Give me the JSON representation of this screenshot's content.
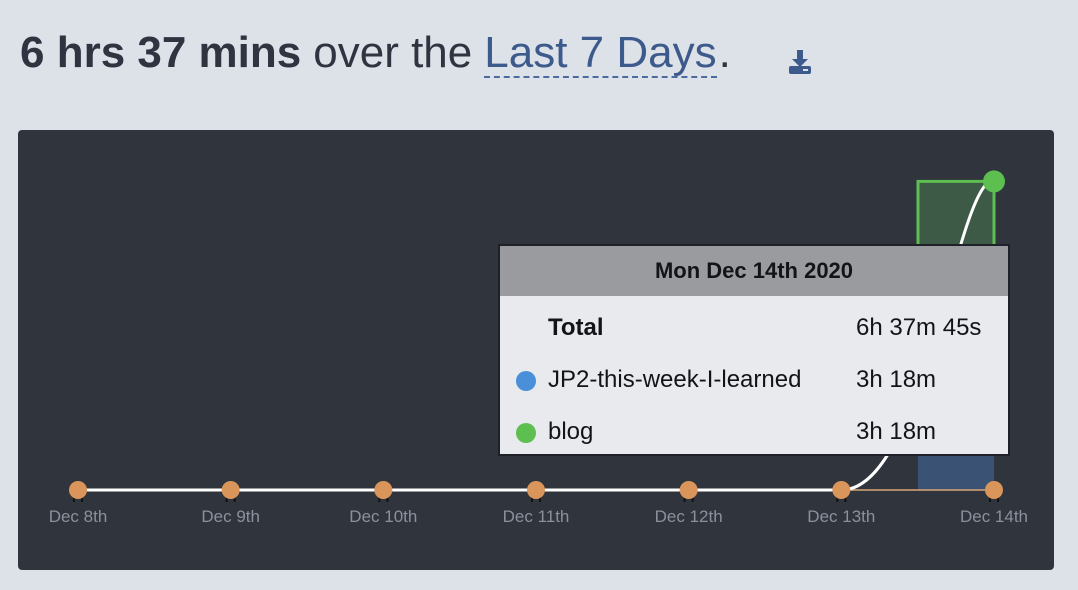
{
  "header": {
    "total": "6 hrs 37 mins",
    "mid_text": "over the",
    "range_link": "Last 7 Days",
    "period": ".",
    "download_icon": "download-icon"
  },
  "colors": {
    "background": "#dde1e8",
    "panel": "#30343d",
    "axis_dot": "#d9955a",
    "blog": "#5cbf4f",
    "jp2": "#4a90d9",
    "line": "#ffffff"
  },
  "chart_data": {
    "type": "area",
    "categories": [
      "Dec 8th",
      "Dec 9th",
      "Dec 10th",
      "Dec 11th",
      "Dec 12th",
      "Dec 13th",
      "Dec 14th"
    ],
    "series": [
      {
        "name": "JP2-this-week-I-learned",
        "values": [
          0,
          0,
          0,
          0,
          0,
          0,
          3.3
        ]
      },
      {
        "name": "blog",
        "values": [
          0,
          0,
          0,
          0,
          0,
          0,
          3.3
        ]
      }
    ],
    "total_hours": [
      0,
      0,
      0,
      0,
      0,
      0,
      6.63
    ],
    "ylim": [
      0,
      6.63
    ],
    "grid": false,
    "legend": "none",
    "highlight_index": 6
  },
  "tooltip": {
    "date": "Mon Dec 14th 2020",
    "total_label": "Total",
    "total_value": "6h 37m 45s",
    "rows": [
      {
        "name": "JP2-this-week-I-learned",
        "value": "3h 18m",
        "color": "#4a90d9"
      },
      {
        "name": "blog",
        "value": "3h 18m",
        "color": "#5cbf4f"
      }
    ]
  }
}
